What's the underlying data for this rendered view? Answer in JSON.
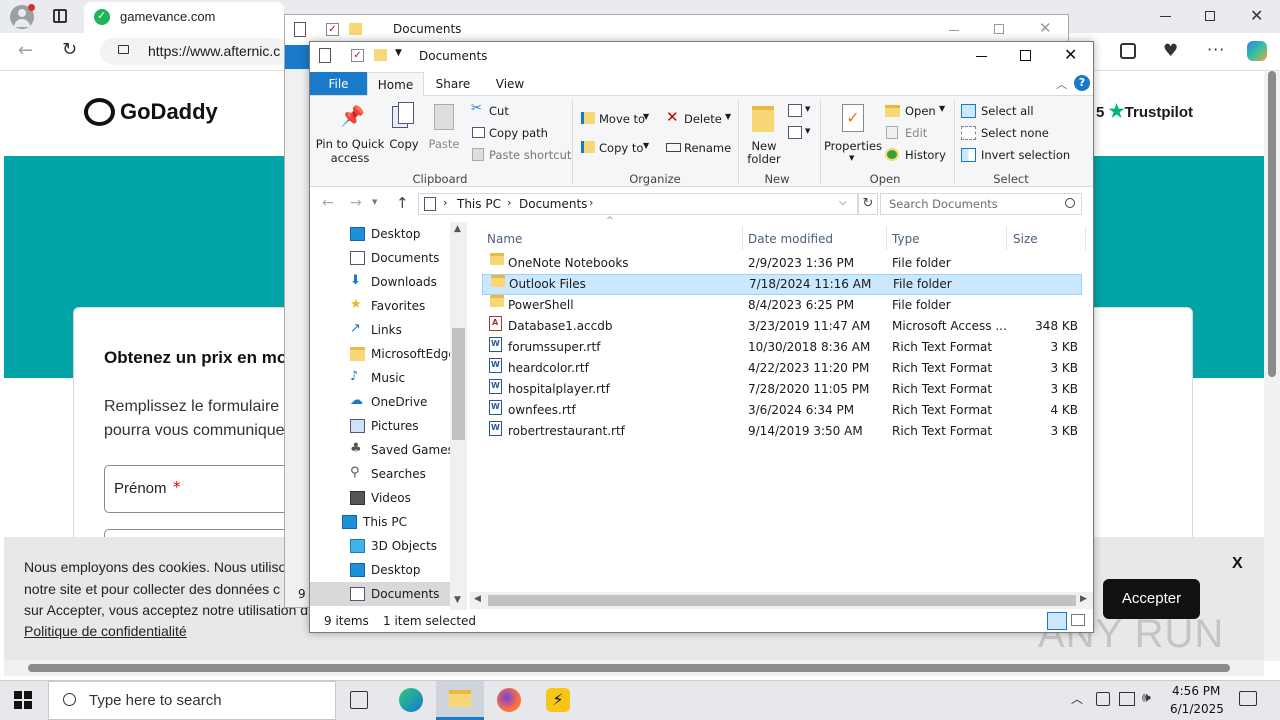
{
  "browser": {
    "tab_title": "gamevance.com",
    "url": "https://www.afternic.c",
    "window_controls": [
      "minimize",
      "restore",
      "close"
    ]
  },
  "webpage": {
    "brand": "GoDaddy",
    "trustpilot": "Trustpilot",
    "trustpilot_prefix": "5",
    "form_title": "Obtenez un prix en mo",
    "form_text_1": "Remplissez le formulaire c",
    "form_text_2": "pourra vous communique",
    "firstname_label": "Prénom",
    "required_mark": "*",
    "cookie_text_1": "Nous employons des cookies. Nous utilisor",
    "cookie_text_2": "notre site et pour collecter des données c",
    "cookie_text_3": "sur Accepter, vous acceptez notre utilisation d",
    "cookie_link": "Politique de confidentialité",
    "cookie_close": "X",
    "accept_label": "Accepter",
    "watermark": "ANY RUN"
  },
  "explorer_back": {
    "title": "Documents",
    "status_count": "9 i"
  },
  "explorer": {
    "title": "Documents",
    "tabs": [
      "File",
      "Home",
      "Share",
      "View"
    ],
    "active_tab": "Home",
    "ribbon": {
      "clipboard": {
        "pin": "Pin to Quick access",
        "pin_l1": "Pin to Quick",
        "pin_l2": "access",
        "copy": "Copy",
        "paste": "Paste",
        "cut": "Cut",
        "copy_path": "Copy path",
        "paste_shortcut": "Paste shortcut",
        "label": "Clipboard"
      },
      "organize": {
        "move_to": "Move to",
        "copy_to": "Copy to",
        "delete": "Delete",
        "rename": "Rename",
        "label": "Organize"
      },
      "new": {
        "new_folder_l1": "New",
        "new_folder_l2": "folder",
        "label": "New"
      },
      "open": {
        "properties": "Properties",
        "open": "Open",
        "edit": "Edit",
        "history": "History",
        "label": "Open"
      },
      "select": {
        "select_all": "Select all",
        "select_none": "Select none",
        "invert": "Invert selection",
        "label": "Select"
      }
    },
    "breadcrumb": [
      "This PC",
      "Documents"
    ],
    "search_placeholder": "Search Documents",
    "nav": [
      {
        "label": "Desktop",
        "icon": "desktop-icon",
        "indent": 1
      },
      {
        "label": "Documents",
        "icon": "documents-icon",
        "indent": 1
      },
      {
        "label": "Downloads",
        "icon": "downloads-icon",
        "indent": 1
      },
      {
        "label": "Favorites",
        "icon": "star-icon",
        "indent": 1
      },
      {
        "label": "Links",
        "icon": "links-icon",
        "indent": 1
      },
      {
        "label": "MicrosoftEdge",
        "icon": "folder-icon",
        "indent": 1
      },
      {
        "label": "Music",
        "icon": "music-icon",
        "indent": 1
      },
      {
        "label": "OneDrive",
        "icon": "onedrive-icon",
        "indent": 1
      },
      {
        "label": "Pictures",
        "icon": "pictures-icon",
        "indent": 1
      },
      {
        "label": "Saved Games",
        "icon": "saved-games-icon",
        "indent": 1
      },
      {
        "label": "Searches",
        "icon": "searches-icon",
        "indent": 1
      },
      {
        "label": "Videos",
        "icon": "videos-icon",
        "indent": 1
      },
      {
        "label": "This PC",
        "icon": "this-pc-icon",
        "indent": 0
      },
      {
        "label": "3D Objects",
        "icon": "3d-objects-icon",
        "indent": 1
      },
      {
        "label": "Desktop",
        "icon": "desktop-icon",
        "indent": 1
      },
      {
        "label": "Documents",
        "icon": "documents-icon",
        "indent": 1,
        "selected": true
      }
    ],
    "columns": [
      "Name",
      "Date modified",
      "Type",
      "Size"
    ],
    "files": [
      {
        "name": "OneNote Notebooks",
        "date": "2/9/2023 1:36 PM",
        "type": "File folder",
        "size": "",
        "kind": "folder"
      },
      {
        "name": "Outlook Files",
        "date": "7/18/2024 11:16 AM",
        "type": "File folder",
        "size": "",
        "kind": "folder",
        "selected": true
      },
      {
        "name": "PowerShell",
        "date": "8/4/2023 6:25 PM",
        "type": "File folder",
        "size": "",
        "kind": "folder"
      },
      {
        "name": "Database1.accdb",
        "date": "3/23/2019 11:47 AM",
        "type": "Microsoft Access ...",
        "size": "348 KB",
        "kind": "access"
      },
      {
        "name": "forumssuper.rtf",
        "date": "10/30/2018 8:36 AM",
        "type": "Rich Text Format",
        "size": "3 KB",
        "kind": "rtf"
      },
      {
        "name": "heardcolor.rtf",
        "date": "4/22/2023 11:20 PM",
        "type": "Rich Text Format",
        "size": "3 KB",
        "kind": "rtf"
      },
      {
        "name": "hospitalplayer.rtf",
        "date": "7/28/2020 11:05 PM",
        "type": "Rich Text Format",
        "size": "3 KB",
        "kind": "rtf"
      },
      {
        "name": "ownfees.rtf",
        "date": "3/6/2024 6:34 PM",
        "type": "Rich Text Format",
        "size": "4 KB",
        "kind": "rtf"
      },
      {
        "name": "robertrestaurant.rtf",
        "date": "9/14/2019 3:50 AM",
        "type": "Rich Text Format",
        "size": "3 KB",
        "kind": "rtf"
      }
    ],
    "status_items": "9 items",
    "status_selected": "1 item selected"
  },
  "taskbar": {
    "search_placeholder": "Type here to search",
    "time": "4:56 PM",
    "date": "6/1/2025"
  },
  "colors": {
    "teal": "#00a4a6",
    "explorer_accent": "#1979ca",
    "selection": "#cce8ff"
  }
}
